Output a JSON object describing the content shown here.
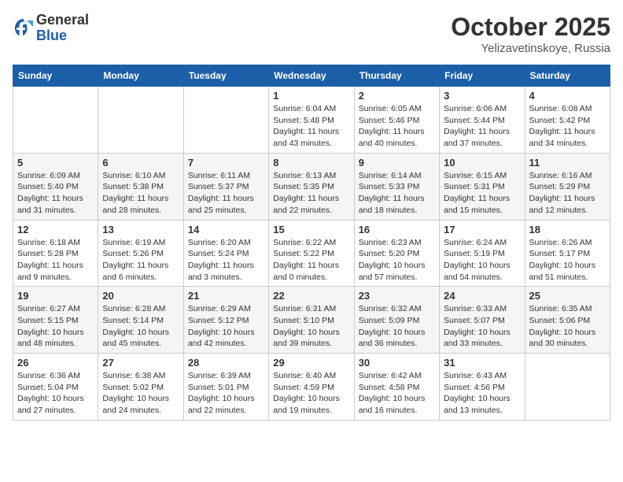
{
  "header": {
    "logo_general": "General",
    "logo_blue": "Blue",
    "month": "October 2025",
    "location": "Yelizavetinskoye, Russia"
  },
  "weekdays": [
    "Sunday",
    "Monday",
    "Tuesday",
    "Wednesday",
    "Thursday",
    "Friday",
    "Saturday"
  ],
  "weeks": [
    [
      {
        "day": "",
        "info": ""
      },
      {
        "day": "",
        "info": ""
      },
      {
        "day": "",
        "info": ""
      },
      {
        "day": "1",
        "info": "Sunrise: 6:04 AM\nSunset: 5:48 PM\nDaylight: 11 hours and 43 minutes."
      },
      {
        "day": "2",
        "info": "Sunrise: 6:05 AM\nSunset: 5:46 PM\nDaylight: 11 hours and 40 minutes."
      },
      {
        "day": "3",
        "info": "Sunrise: 6:06 AM\nSunset: 5:44 PM\nDaylight: 11 hours and 37 minutes."
      },
      {
        "day": "4",
        "info": "Sunrise: 6:08 AM\nSunset: 5:42 PM\nDaylight: 11 hours and 34 minutes."
      }
    ],
    [
      {
        "day": "5",
        "info": "Sunrise: 6:09 AM\nSunset: 5:40 PM\nDaylight: 11 hours and 31 minutes."
      },
      {
        "day": "6",
        "info": "Sunrise: 6:10 AM\nSunset: 5:38 PM\nDaylight: 11 hours and 28 minutes."
      },
      {
        "day": "7",
        "info": "Sunrise: 6:11 AM\nSunset: 5:37 PM\nDaylight: 11 hours and 25 minutes."
      },
      {
        "day": "8",
        "info": "Sunrise: 6:13 AM\nSunset: 5:35 PM\nDaylight: 11 hours and 22 minutes."
      },
      {
        "day": "9",
        "info": "Sunrise: 6:14 AM\nSunset: 5:33 PM\nDaylight: 11 hours and 18 minutes."
      },
      {
        "day": "10",
        "info": "Sunrise: 6:15 AM\nSunset: 5:31 PM\nDaylight: 11 hours and 15 minutes."
      },
      {
        "day": "11",
        "info": "Sunrise: 6:16 AM\nSunset: 5:29 PM\nDaylight: 11 hours and 12 minutes."
      }
    ],
    [
      {
        "day": "12",
        "info": "Sunrise: 6:18 AM\nSunset: 5:28 PM\nDaylight: 11 hours and 9 minutes."
      },
      {
        "day": "13",
        "info": "Sunrise: 6:19 AM\nSunset: 5:26 PM\nDaylight: 11 hours and 6 minutes."
      },
      {
        "day": "14",
        "info": "Sunrise: 6:20 AM\nSunset: 5:24 PM\nDaylight: 11 hours and 3 minutes."
      },
      {
        "day": "15",
        "info": "Sunrise: 6:22 AM\nSunset: 5:22 PM\nDaylight: 11 hours and 0 minutes."
      },
      {
        "day": "16",
        "info": "Sunrise: 6:23 AM\nSunset: 5:20 PM\nDaylight: 10 hours and 57 minutes."
      },
      {
        "day": "17",
        "info": "Sunrise: 6:24 AM\nSunset: 5:19 PM\nDaylight: 10 hours and 54 minutes."
      },
      {
        "day": "18",
        "info": "Sunrise: 6:26 AM\nSunset: 5:17 PM\nDaylight: 10 hours and 51 minutes."
      }
    ],
    [
      {
        "day": "19",
        "info": "Sunrise: 6:27 AM\nSunset: 5:15 PM\nDaylight: 10 hours and 48 minutes."
      },
      {
        "day": "20",
        "info": "Sunrise: 6:28 AM\nSunset: 5:14 PM\nDaylight: 10 hours and 45 minutes."
      },
      {
        "day": "21",
        "info": "Sunrise: 6:29 AM\nSunset: 5:12 PM\nDaylight: 10 hours and 42 minutes."
      },
      {
        "day": "22",
        "info": "Sunrise: 6:31 AM\nSunset: 5:10 PM\nDaylight: 10 hours and 39 minutes."
      },
      {
        "day": "23",
        "info": "Sunrise: 6:32 AM\nSunset: 5:09 PM\nDaylight: 10 hours and 36 minutes."
      },
      {
        "day": "24",
        "info": "Sunrise: 6:33 AM\nSunset: 5:07 PM\nDaylight: 10 hours and 33 minutes."
      },
      {
        "day": "25",
        "info": "Sunrise: 6:35 AM\nSunset: 5:06 PM\nDaylight: 10 hours and 30 minutes."
      }
    ],
    [
      {
        "day": "26",
        "info": "Sunrise: 6:36 AM\nSunset: 5:04 PM\nDaylight: 10 hours and 27 minutes."
      },
      {
        "day": "27",
        "info": "Sunrise: 6:38 AM\nSunset: 5:02 PM\nDaylight: 10 hours and 24 minutes."
      },
      {
        "day": "28",
        "info": "Sunrise: 6:39 AM\nSunset: 5:01 PM\nDaylight: 10 hours and 22 minutes."
      },
      {
        "day": "29",
        "info": "Sunrise: 6:40 AM\nSunset: 4:59 PM\nDaylight: 10 hours and 19 minutes."
      },
      {
        "day": "30",
        "info": "Sunrise: 6:42 AM\nSunset: 4:58 PM\nDaylight: 10 hours and 16 minutes."
      },
      {
        "day": "31",
        "info": "Sunrise: 6:43 AM\nSunset: 4:56 PM\nDaylight: 10 hours and 13 minutes."
      },
      {
        "day": "",
        "info": ""
      }
    ]
  ]
}
